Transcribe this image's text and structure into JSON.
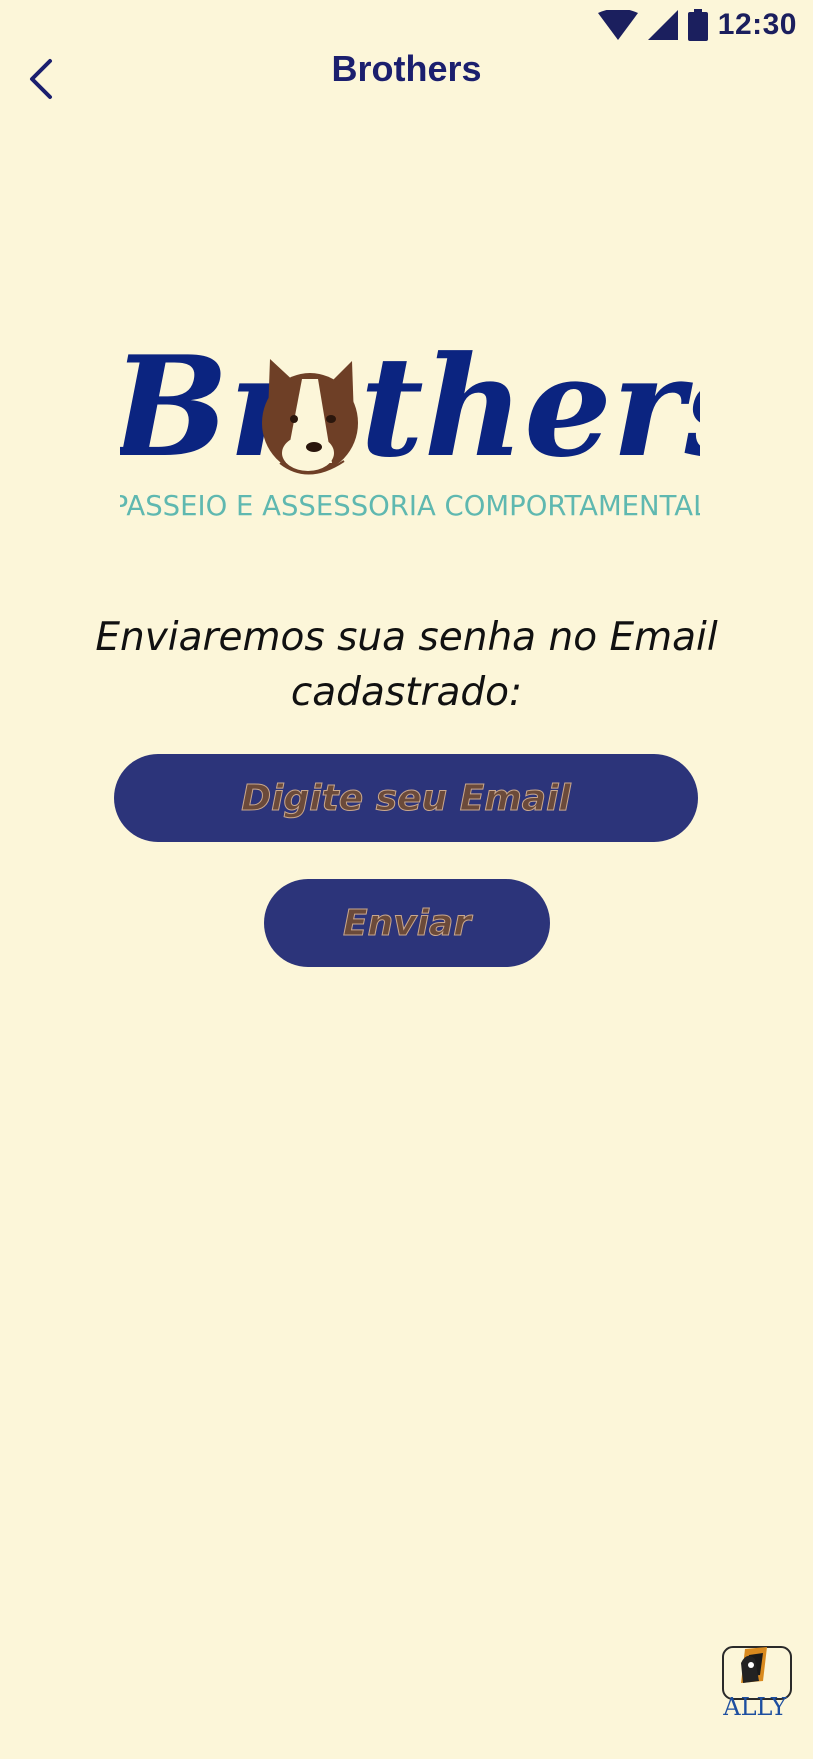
{
  "status_bar": {
    "time": "12:30",
    "icons": [
      "wifi-icon",
      "cell-signal-icon",
      "battery-icon"
    ]
  },
  "app_bar": {
    "title": "Brothers",
    "back_icon": "chevron-left-icon"
  },
  "logo": {
    "brand_prefix": "Br",
    "brand_suffix": "thers",
    "tagline": "PASSEIO E ASSESSORIA COMPORTAMENTAL"
  },
  "form": {
    "instruction_line1": "Enviaremos sua senha no Email",
    "instruction_line2": "cadastrado:",
    "email_placeholder": "Digite seu Email",
    "email_value": "",
    "send_label": "Enviar"
  },
  "footer": {
    "badge_text": "ALLY"
  },
  "colors": {
    "background": "#fcf6d9",
    "primary": "#2c347a",
    "brand_navy": "#0b2480",
    "brand_brown": "#6e3f26",
    "tagline_teal": "#5fb8b0",
    "button_text": "#6b4a3a"
  }
}
